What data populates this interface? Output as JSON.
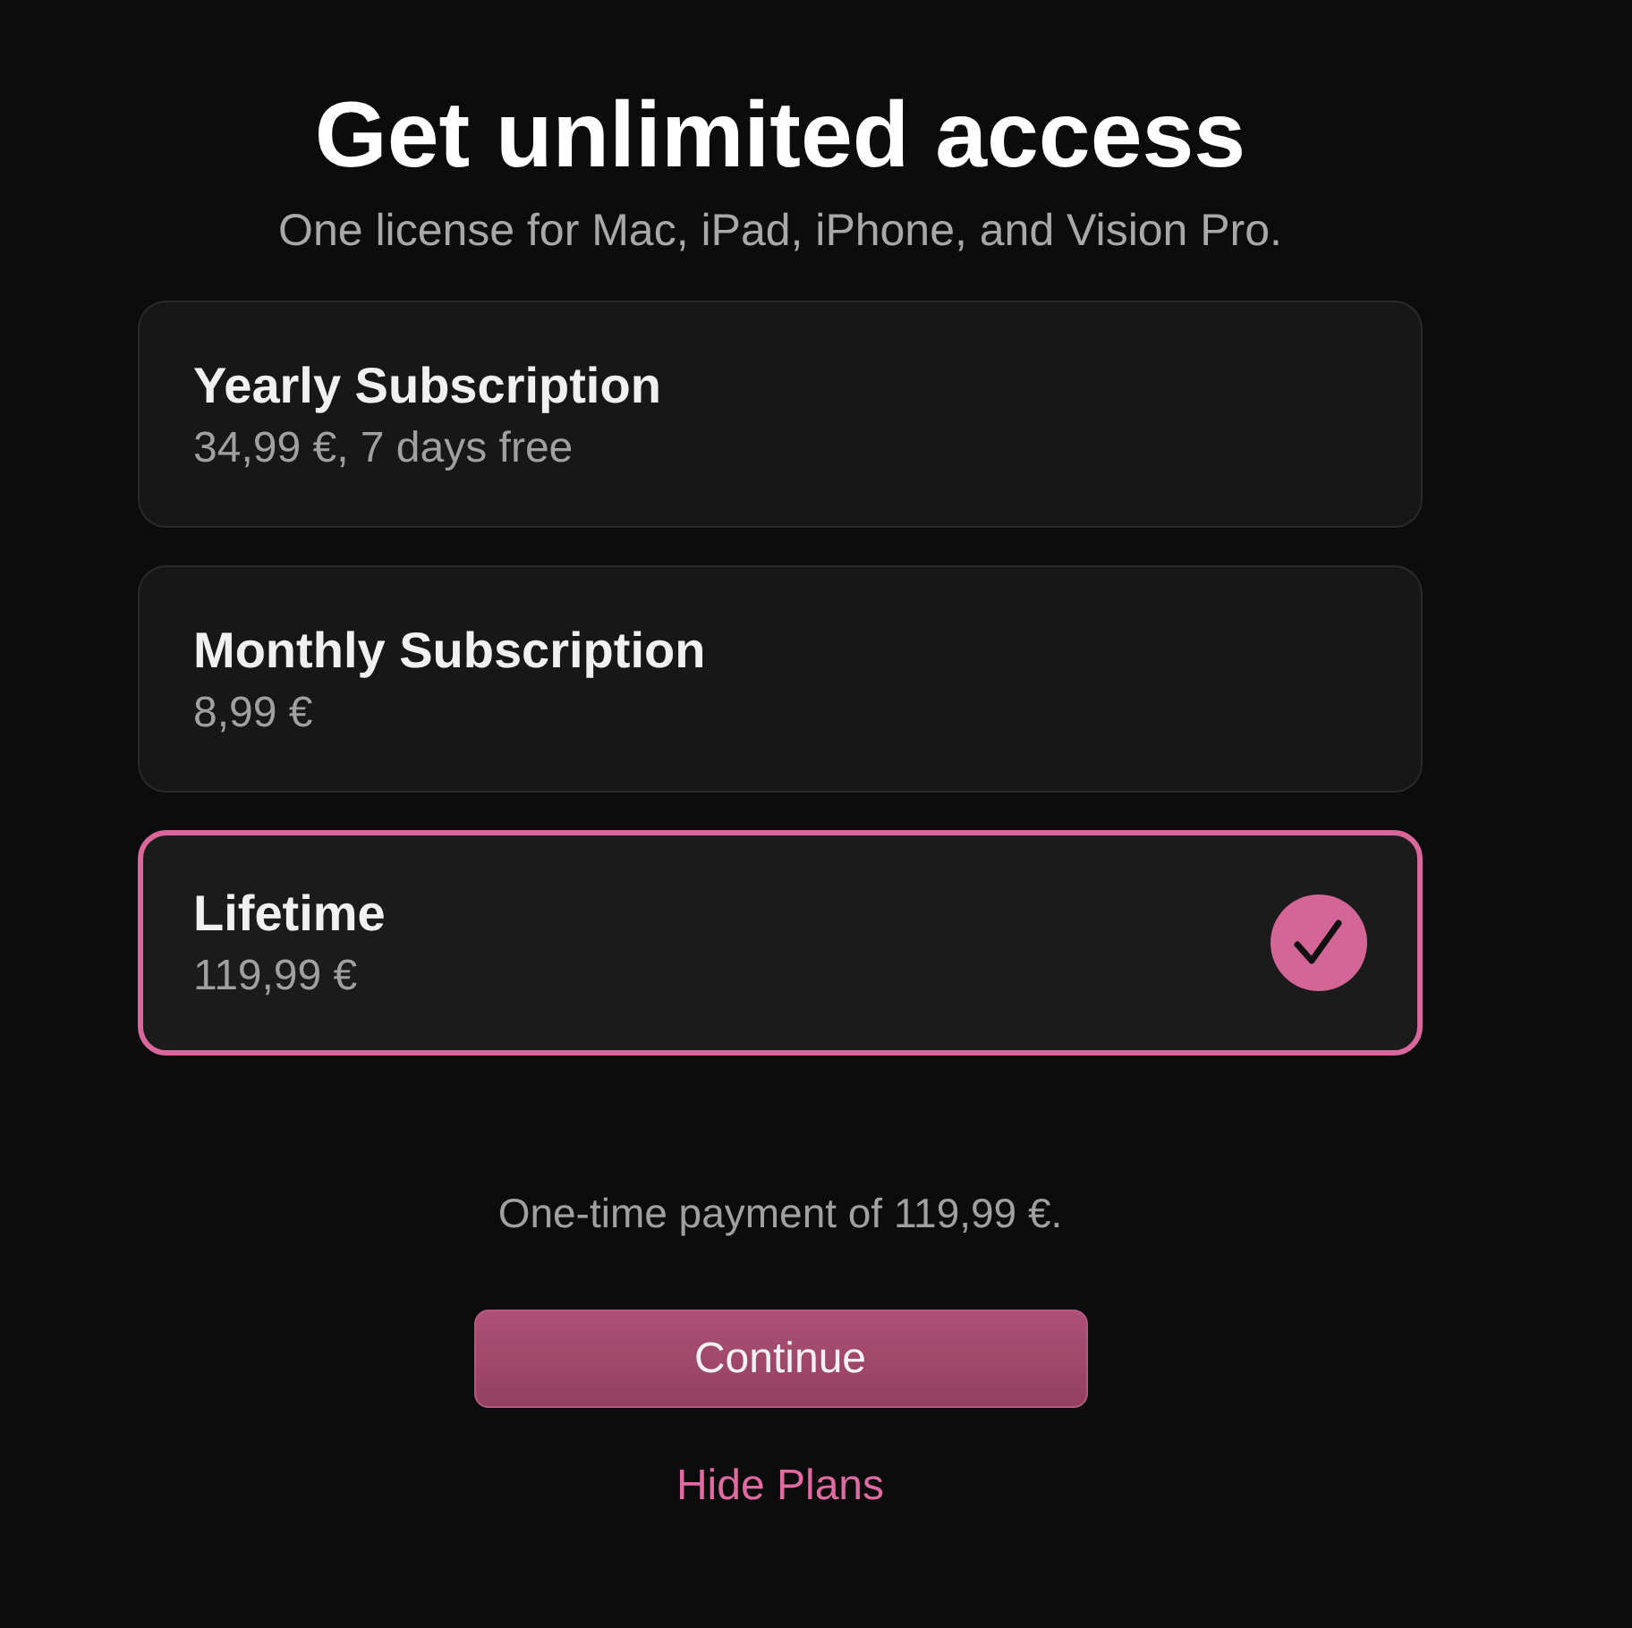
{
  "title": "Get unlimited access",
  "subtitle": "One license for Mac, iPad, iPhone, and Vision Pro.",
  "plans": [
    {
      "name": "Yearly Subscription",
      "price": "34,99 €, 7 days free",
      "selected": false
    },
    {
      "name": "Monthly Subscription",
      "price": "8,99 €",
      "selected": false
    },
    {
      "name": "Lifetime",
      "price": "119,99 €",
      "selected": true
    }
  ],
  "summary": "One-time payment of 119,99 €.",
  "continue_button": "Continue",
  "hide_plans_link": "Hide Plans"
}
